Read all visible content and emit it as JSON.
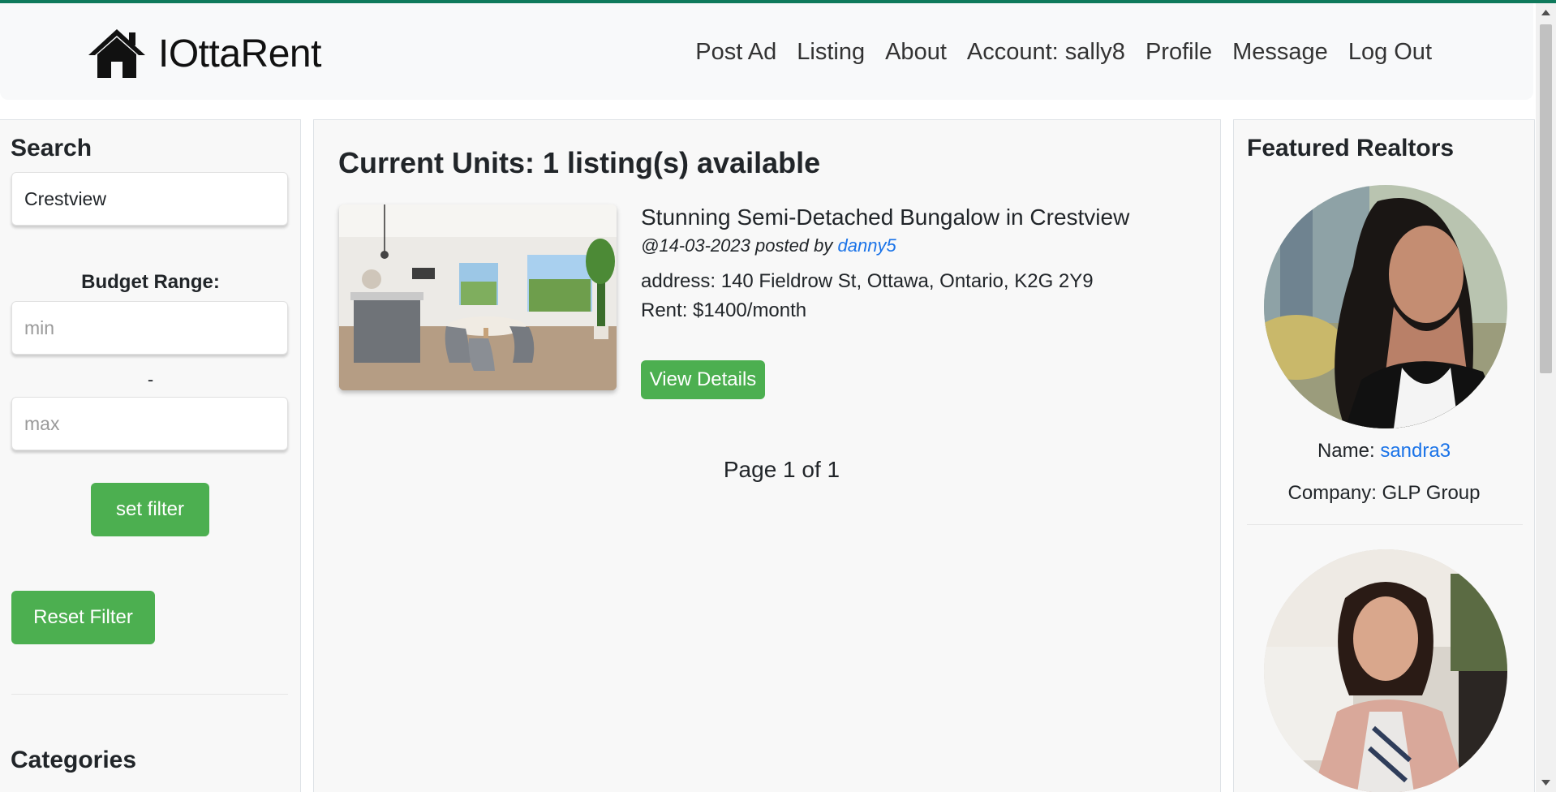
{
  "navbar": {
    "brand": "IOttaRent",
    "links": [
      "Post Ad",
      "Listing",
      "About",
      "Account: sally8",
      "Profile",
      "Message",
      "Log Out"
    ]
  },
  "sidebar": {
    "search_heading": "Search",
    "search_value": "Crestview",
    "budget_label": "Budget Range:",
    "min_placeholder": "min",
    "separator": "-",
    "max_placeholder": "max",
    "set_filter_label": "set filter",
    "reset_filter_label": "Reset Filter",
    "categories_heading": "Categories"
  },
  "main": {
    "heading": "Current Units: 1 listing(s) available",
    "listings": [
      {
        "title": "Stunning Semi-Detached Bungalow in Crestview",
        "date_prefix": "@14-03-2023 posted by ",
        "poster": "danny5",
        "address": "address: 140 Fieldrow St, Ottawa, Ontario, K2G 2Y9",
        "rent": "Rent: $1400/month",
        "details_label": "View Details"
      }
    ],
    "pagination": "Page 1 of 1"
  },
  "featured": {
    "heading": "Featured Realtors",
    "realtors": [
      {
        "name_label": "Name: ",
        "name": "sandra3",
        "company": "Company: GLP Group"
      }
    ]
  },
  "colors": {
    "accent_green": "#4caf50",
    "link_blue": "#1a73e8",
    "top_border": "#0f7a5c"
  }
}
